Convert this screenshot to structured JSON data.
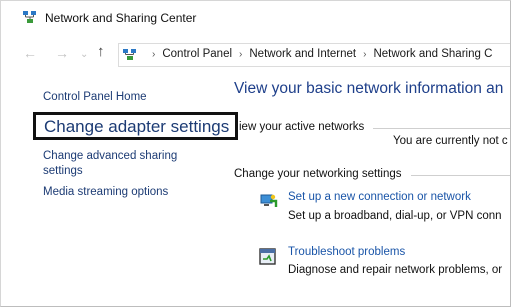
{
  "window": {
    "title": "Network and Sharing Center",
    "title_icon": "network-sharing-icon"
  },
  "addressbar": {
    "back_icon": "arrow-left-icon",
    "forward_icon": "arrow-right-icon",
    "recent_icon": "chevron-down-icon",
    "up_icon": "arrow-up-icon",
    "location_icon": "control-panel-icon",
    "breadcrumbs": [
      "Control Panel",
      "Network and Internet",
      "Network and Sharing C"
    ]
  },
  "sidebar": {
    "home": "Control Panel Home",
    "adapter": "Change adapter settings",
    "sharing": "Change advanced sharing settings",
    "media": "Media streaming options"
  },
  "main": {
    "title": "View your basic network information an",
    "active_networks_label": "iew your active networks",
    "connection_status": "You are currently not c",
    "change_settings_label": "Change your networking settings",
    "tasks": [
      {
        "icon": "new-connection-icon",
        "link": "Set up a new connection or network",
        "description": "Set up a broadband, dial-up, or VPN conn"
      },
      {
        "icon": "troubleshoot-icon",
        "link": "Troubleshoot problems",
        "description": "Diagnose and repair network problems, or"
      }
    ]
  },
  "colors": {
    "link": "#1a55a8",
    "sidebar_link": "#1c3b74",
    "heading": "#1e3f8a",
    "highlight_border": "#111111"
  }
}
